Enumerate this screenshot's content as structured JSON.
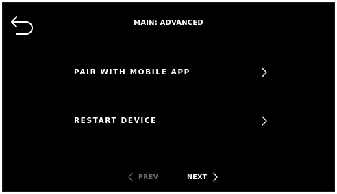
{
  "header": {
    "title": "MAIN: ADVANCED",
    "back_icon": "undo-arrow-icon"
  },
  "menu": {
    "items": [
      {
        "label": "PAIR WITH MOBILE APP",
        "icon": "chevron-right-icon"
      },
      {
        "label": "RESTART DEVICE",
        "icon": "chevron-right-icon"
      }
    ]
  },
  "pagination": {
    "prev_label": "PREV",
    "next_label": "NEXT",
    "prev_enabled": false,
    "next_enabled": true
  },
  "colors": {
    "background": "#000000",
    "text": "#ffffff",
    "disabled": "#6b6b6b"
  }
}
